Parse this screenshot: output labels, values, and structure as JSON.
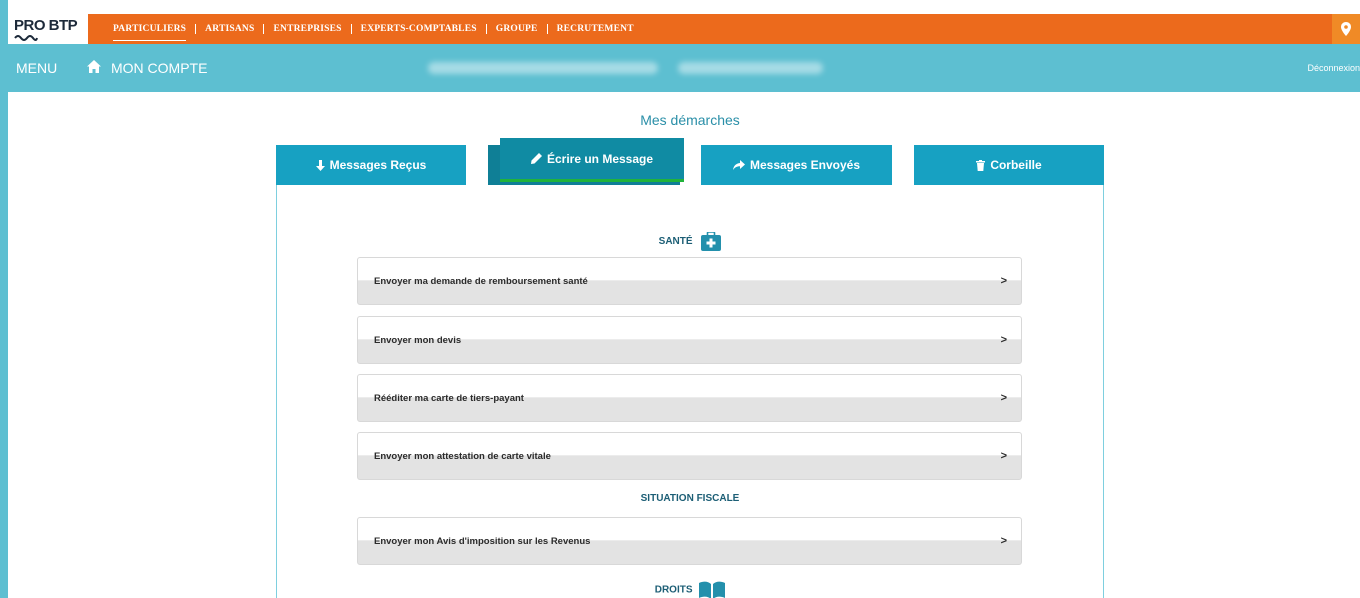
{
  "brand": {
    "logo_text": "PRO BTP"
  },
  "topnav": {
    "items": [
      {
        "label": "PARTICULIERS",
        "active": true
      },
      {
        "label": "ARTISANS"
      },
      {
        "label": "ENTREPRISES"
      },
      {
        "label": "EXPERTS-COMPTABLES"
      },
      {
        "label": "GROUPE"
      },
      {
        "label": "RECRUTEMENT"
      }
    ],
    "location_icon": "map-pin-icon"
  },
  "header": {
    "menu_label": "MENU",
    "account_label": "MON COMPTE",
    "logout_label": "Déconnexion"
  },
  "page": {
    "title": "Mes démarches"
  },
  "tabs": [
    {
      "label": "Messages Reçus",
      "icon": "arrow-down-icon"
    },
    {
      "label": "Écrire un Message",
      "icon": "pencil-icon",
      "active": true
    },
    {
      "label": "Messages Envoyés",
      "icon": "share-arrow-icon"
    },
    {
      "label": "Corbeille",
      "icon": "trash-icon"
    }
  ],
  "sections": {
    "sante": {
      "title": "SANTÉ",
      "icon": "medical-kit-icon",
      "items": [
        {
          "label": "Envoyer ma demande de remboursement santé",
          "arrow": ">"
        },
        {
          "label": "Envoyer mon devis",
          "arrow": ">"
        },
        {
          "label": "Rééditer ma carte de tiers-payant",
          "arrow": ">"
        },
        {
          "label": "Envoyer mon attestation de carte vitale",
          "arrow": ">"
        }
      ]
    },
    "fiscale": {
      "title": "SITUATION FISCALE",
      "items": [
        {
          "label": "Envoyer mon Avis d'imposition sur les Revenus",
          "arrow": ">"
        }
      ]
    },
    "droits": {
      "title": "DROITS",
      "icon": "book-icon"
    }
  },
  "colors": {
    "orange": "#ec6a1c",
    "teal": "#5dbfd1",
    "tab_blue": "#17a1c2",
    "tab_active": "#108ba3",
    "section_text": "#1c5e75"
  }
}
